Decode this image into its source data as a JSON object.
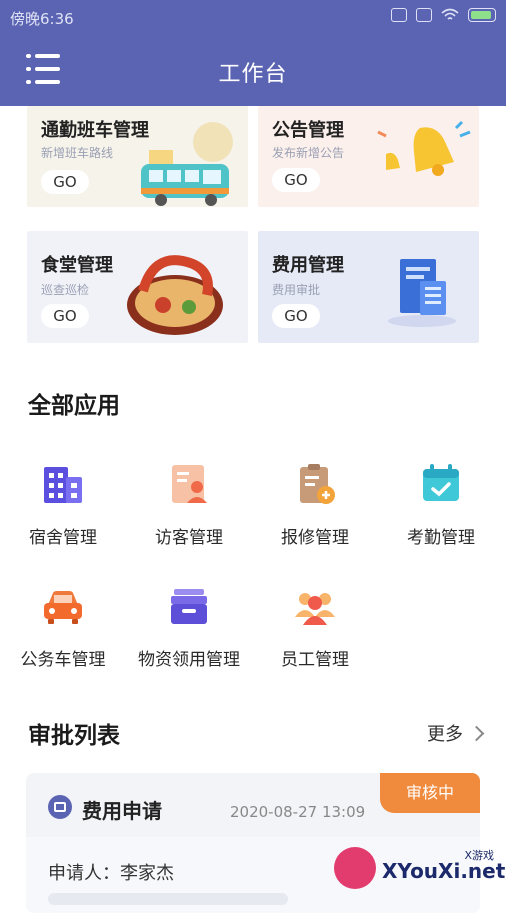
{
  "status_bar": {
    "time": "傍晚6:36"
  },
  "header": {
    "title": "工作台"
  },
  "cards": [
    {
      "title": "通勤班车管理",
      "subtitle": "新增班车路线",
      "go": "GO"
    },
    {
      "title": "公告管理",
      "subtitle": "发布新增公告",
      "go": "GO"
    },
    {
      "title": "食堂管理",
      "subtitle": "巡查巡检",
      "go": "GO"
    },
    {
      "title": "费用管理",
      "subtitle": "费用审批",
      "go": "GO"
    }
  ],
  "all_apps": {
    "title": "全部应用",
    "items": [
      {
        "label": "宿舍管理",
        "icon": "building-icon"
      },
      {
        "label": "访客管理",
        "icon": "visitor-icon"
      },
      {
        "label": "报修管理",
        "icon": "repair-icon"
      },
      {
        "label": "考勤管理",
        "icon": "calendar-check-icon"
      },
      {
        "label": "公务车管理",
        "icon": "car-icon"
      },
      {
        "label": "物资领用管理",
        "icon": "box-icon"
      },
      {
        "label": "员工管理",
        "icon": "staff-icon"
      }
    ]
  },
  "approvals": {
    "title": "审批列表",
    "more": "更多",
    "item": {
      "title": "费用申请",
      "date": "2020-08-27 13:09",
      "status": "审核中",
      "applicant": "申请人：李家杰"
    }
  },
  "watermark": {
    "text": "XYouXi.net",
    "small": "X游戏"
  },
  "colors": {
    "header": "#5a64b2",
    "status_badge": "#f08a3c"
  }
}
